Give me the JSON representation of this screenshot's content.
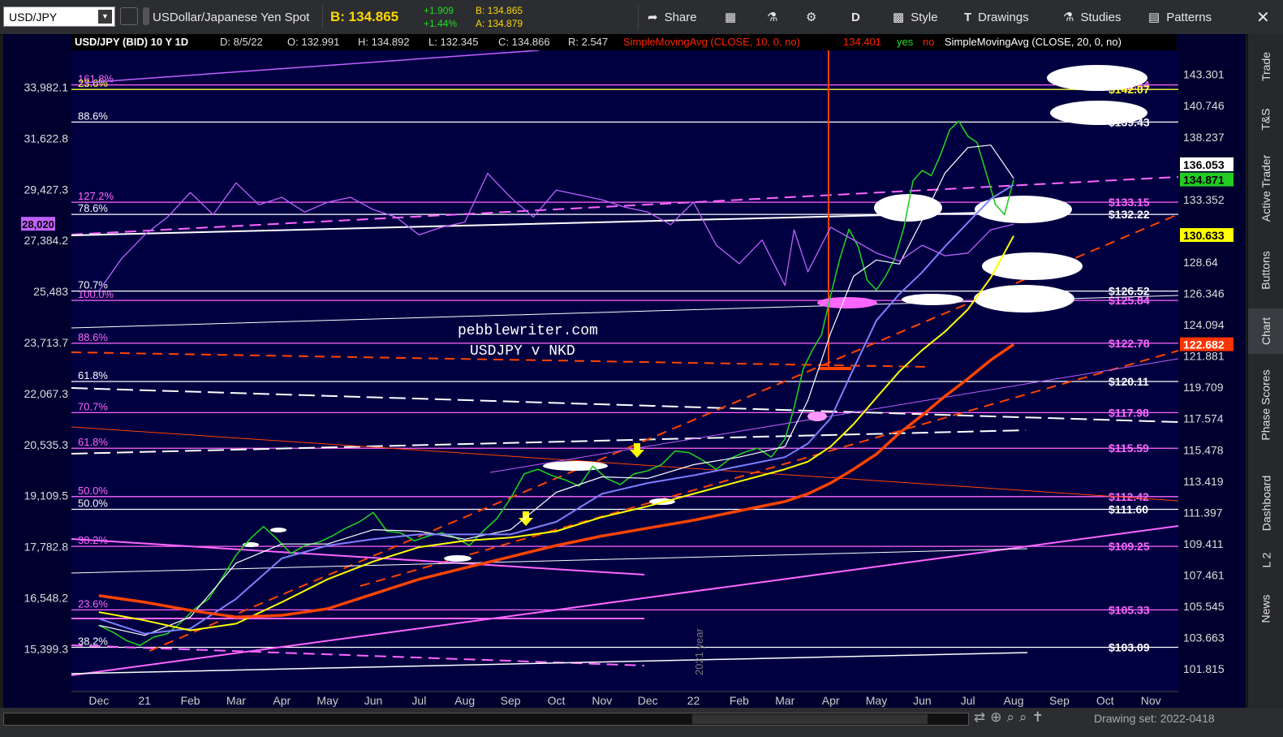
{
  "toolbar": {
    "symbol": "USD/JPY",
    "description": "USDollar/Japanese Yen Spot",
    "bid_label": "B: 134.865",
    "change_abs": "+1.909",
    "change_pct": "+1.44%",
    "bid_small": "B: 134.865",
    "ask_small": "A: 134.879",
    "share": "Share",
    "period": "D",
    "style": "Style",
    "drawings": "Drawings",
    "studies": "Studies",
    "patterns": "Patterns"
  },
  "sidebar": {
    "tabs": [
      "Trade",
      "T&S",
      "Active Trader",
      "Buttons",
      "Chart",
      "Phase Scores",
      "Dashboard",
      "L 2",
      "News"
    ]
  },
  "footer": {
    "drawing_set": "Drawing set: 2022-0418"
  },
  "colors": {
    "background": "#00002e",
    "price": "#22cc22",
    "sma10": "#ff2200",
    "sma20": "#ffffff",
    "sma50": "#7f7fff",
    "sma100": "#ffff00",
    "sma200": "#ff4400",
    "nikkei": "#c060ff",
    "fib": "#ff66ff"
  },
  "chart_data": {
    "type": "line",
    "header": {
      "title": "USD/JPY (BID) 10 Y 1D",
      "date": "D: 8/5/22",
      "open": "O: 132.991",
      "high": "H: 134.892",
      "low": "L: 132.345",
      "close": "C: 134.866",
      "range": "R: 2.547",
      "study1": "SimpleMovingAvg (CLOSE, 10, 0, no)",
      "study1_value": "134.401",
      "flag_yes": "yes",
      "flag_no": "no",
      "study2": "SimpleMovingAvg (CLOSE, 20, 0, no)"
    },
    "annotation_lines": [
      "pebblewriter.com",
      "USDJPY v NKD"
    ],
    "vertical_label": "2021 year",
    "x_ticks": [
      "Dec",
      "21",
      "Feb",
      "Mar",
      "Apr",
      "May",
      "Jun",
      "Jul",
      "Aug",
      "Sep",
      "Oct",
      "Nov",
      "Dec",
      "22",
      "Feb",
      "Mar",
      "Apr",
      "May",
      "Jun",
      "Jul",
      "Aug",
      "Sep",
      "Oct",
      "Nov"
    ],
    "x_tick_months": [
      0,
      1,
      2,
      3,
      4,
      5,
      6,
      7,
      8,
      9,
      10,
      11,
      12,
      13,
      14,
      15,
      16,
      17,
      18,
      19,
      20,
      21,
      22,
      23
    ],
    "xlim_months": [
      -0.6,
      23.6
    ],
    "right_axis": {
      "ylim": [
        100.5,
        145.3
      ],
      "ticks": [
        "143.301",
        "140.746",
        "138.237",
        "133.352",
        "128.64",
        "126.346",
        "124.094",
        "121.881",
        "119.709",
        "117.574",
        "115.478",
        "113.419",
        "111.397",
        "109.411",
        "107.461",
        "105.545",
        "103.663",
        "101.815"
      ],
      "tick_values": [
        143.301,
        140.746,
        138.237,
        133.352,
        128.64,
        126.346,
        124.094,
        121.881,
        119.709,
        117.574,
        115.478,
        113.419,
        111.397,
        109.411,
        107.461,
        105.545,
        103.663,
        101.815
      ]
    },
    "left_axis": {
      "ylim": [
        14500,
        35800
      ],
      "ticks": [
        "33,982.1",
        "31,622.8",
        "29,427.3",
        "27,384.2",
        "25,483",
        "23,713.7",
        "22,067.3",
        "20,535.3",
        "19,109.5",
        "17,782.8",
        "16,548.2",
        "15,399.3"
      ],
      "tick_values": [
        33982.1,
        31622.8,
        29427.3,
        27384.2,
        25483,
        23713.7,
        22067.3,
        20535.3,
        19109.5,
        17782.8,
        16548.2,
        15399.3
      ],
      "current_label": "28,020",
      "current_value": 28020
    },
    "price_badges": [
      {
        "label": "136.053",
        "value": 136.053,
        "color": "#ffffff",
        "text": "#000000"
      },
      {
        "label": "134.871",
        "value": 134.871,
        "color": "#22cc22",
        "text": "#000000"
      },
      {
        "label": "130.633",
        "value": 130.633,
        "color": "#ffff00",
        "text": "#000000"
      },
      {
        "label": "122.682",
        "value": 122.682,
        "color": "#ff3300",
        "text": "#ffffff"
      }
    ],
    "levels": [
      {
        "left": "161.8%",
        "right": "$142.44",
        "value": 142.44,
        "color": "#ff66ff"
      },
      {
        "left": "23.6%",
        "right": "$142.07",
        "value": 142.07,
        "color": "#ffff33"
      },
      {
        "left": "88.6%",
        "right": "$139.43",
        "value": 139.43,
        "color": "#ffffff"
      },
      {
        "left": "127.2%",
        "right": "$133.15",
        "value": 133.15,
        "color": "#ff66ff"
      },
      {
        "left": "78.6%",
        "right": "$132.22",
        "value": 132.22,
        "color": "#ffffff"
      },
      {
        "left": "70.7%",
        "right": "$126.52",
        "value": 126.52,
        "color": "#ffffff"
      },
      {
        "left": "100.0%",
        "right": "$125.84",
        "value": 125.84,
        "color": "#ff66ff"
      },
      {
        "left": "88.6%",
        "right": "$122.78",
        "value": 122.78,
        "color": "#ff66ff"
      },
      {
        "left": "61.8%",
        "right": "$120.11",
        "value": 120.11,
        "color": "#ffffff"
      },
      {
        "left": "70.7%",
        "right": "$117.98",
        "value": 117.98,
        "color": "#ff66ff"
      },
      {
        "left": "61.8%",
        "right": "$115.59",
        "value": 115.59,
        "color": "#ff66ff"
      },
      {
        "left": "50.0%",
        "right": "$112.42",
        "value": 112.42,
        "color": "#ff66ff"
      },
      {
        "left": "50.0%",
        "right": "$111.60",
        "value": 111.6,
        "color": "#ffffff"
      },
      {
        "left": "38.2%",
        "right": "$109.25",
        "value": 109.25,
        "color": "#ff66ff"
      },
      {
        "left": "23.6%",
        "right": "$105.33",
        "value": 105.33,
        "color": "#ff66ff"
      },
      {
        "left": "38.2%",
        "right": "$103.09",
        "value": 103.09,
        "color": "#ffffff"
      }
    ],
    "series": [
      {
        "key": "price",
        "x": [
          0,
          0.3,
          0.6,
          0.9,
          1.2,
          1.5,
          1.8,
          2.1,
          2.4,
          2.7,
          3.0,
          3.3,
          3.6,
          3.9,
          4.2,
          4.5,
          4.8,
          5.1,
          5.4,
          5.7,
          6.0,
          6.3,
          6.6,
          6.9,
          7.2,
          7.5,
          7.8,
          8.1,
          8.4,
          8.7,
          9.0,
          9.3,
          9.6,
          9.9,
          10.2,
          10.5,
          10.8,
          11.1,
          11.4,
          11.7,
          12.0,
          12.3,
          12.6,
          12.9,
          13.2,
          13.5,
          13.8,
          14.1,
          14.4,
          14.7,
          15.0,
          15.2,
          15.4,
          15.6,
          15.8,
          16.0,
          16.2,
          16.4,
          16.6,
          16.8,
          17.0,
          17.2,
          17.4,
          17.6,
          17.8,
          18.0,
          18.2,
          18.4,
          18.6,
          18.8,
          19.0,
          19.2,
          19.4,
          19.6,
          19.8,
          20.0
        ],
        "y": [
          104.4,
          104.0,
          103.5,
          103.2,
          103.7,
          103.9,
          104.6,
          105.4,
          106.0,
          107.3,
          108.7,
          109.7,
          110.5,
          109.7,
          108.8,
          109.3,
          109.5,
          109.9,
          110.4,
          110.8,
          111.4,
          110.2,
          110.1,
          109.6,
          109.9,
          110.1,
          109.8,
          109.3,
          110.2,
          111.0,
          112.3,
          113.9,
          114.2,
          113.8,
          113.5,
          113.1,
          114.4,
          113.6,
          113.2,
          113.9,
          114.1,
          114.5,
          115.4,
          115.3,
          114.8,
          114.2,
          114.9,
          115.3,
          115.6,
          115.0,
          116.2,
          118.3,
          121.0,
          122.3,
          123.4,
          126.2,
          128.9,
          131.1,
          129.8,
          127.3,
          126.6,
          127.6,
          128.9,
          131.2,
          134.8,
          135.6,
          135.2,
          136.8,
          138.8,
          139.5,
          138.3,
          137.8,
          135.4,
          133.0,
          132.2,
          134.9
        ]
      },
      {
        "key": "sma20",
        "x": [
          0,
          1,
          2,
          3,
          4,
          5,
          6,
          7,
          8,
          9,
          10,
          11,
          12,
          13,
          14,
          15,
          15.5,
          16,
          16.5,
          17,
          17.5,
          18,
          18.5,
          19,
          19.5,
          20
        ],
        "y": [
          104.4,
          103.8,
          104.9,
          108.2,
          109.4,
          109.4,
          110.3,
          110.2,
          109.7,
          110.3,
          112.7,
          113.7,
          113.6,
          114.5,
          115.0,
          115.7,
          118.8,
          123.5,
          127.6,
          128.8,
          128.5,
          131.8,
          135.4,
          137.4,
          137.6,
          135.0
        ]
      },
      {
        "key": "sma50",
        "x": [
          0,
          1,
          2,
          3,
          4,
          5,
          6,
          7,
          8,
          9,
          10,
          11,
          12,
          13,
          14,
          15,
          15.5,
          16,
          16.5,
          17,
          17.5,
          18,
          18.5,
          19,
          19.5,
          20
        ],
        "y": [
          104.8,
          103.9,
          104.2,
          106.0,
          108.5,
          109.3,
          109.7,
          110.0,
          110.0,
          110.0,
          110.8,
          112.6,
          113.3,
          113.8,
          114.4,
          115.0,
          115.9,
          117.6,
          121.0,
          124.4,
          126.3,
          127.9,
          129.8,
          131.6,
          133.4,
          134.5
        ]
      },
      {
        "key": "sma100",
        "x": [
          0,
          1,
          2,
          3,
          4,
          5,
          6,
          7,
          8,
          9,
          10,
          11,
          12,
          13,
          14,
          15,
          15.5,
          16,
          16.5,
          17,
          17.5,
          18,
          18.5,
          19,
          19.5,
          20
        ],
        "y": [
          105.2,
          104.7,
          104.1,
          104.5,
          105.8,
          107.2,
          108.3,
          109.2,
          109.6,
          109.8,
          110.2,
          111.1,
          111.8,
          112.6,
          113.4,
          114.2,
          114.7,
          115.7,
          117.2,
          119.0,
          120.8,
          122.3,
          123.6,
          125.2,
          127.5,
          130.6
        ]
      },
      {
        "key": "sma200",
        "x": [
          0,
          1,
          2,
          3,
          4,
          5,
          6,
          7,
          8,
          9,
          10,
          11,
          12,
          13,
          14,
          15,
          15.5,
          16,
          16.5,
          17,
          17.5,
          18,
          18.5,
          19,
          19.5,
          20
        ],
        "y": [
          106.2,
          105.8,
          105.3,
          104.9,
          105.0,
          105.4,
          106.3,
          107.2,
          107.9,
          108.6,
          109.3,
          109.9,
          110.4,
          110.9,
          111.5,
          112.1,
          112.6,
          113.3,
          114.2,
          115.2,
          116.6,
          117.8,
          119.1,
          120.3,
          121.6,
          122.7
        ]
      },
      {
        "key": "nikkei",
        "x": [
          0,
          0.5,
          1,
          1.5,
          2,
          2.5,
          3,
          3.5,
          4,
          4.5,
          5,
          5.5,
          6,
          6.5,
          7,
          7.5,
          8,
          8.5,
          9,
          9.5,
          10,
          10.5,
          11,
          11.5,
          12,
          12.5,
          13,
          13.5,
          14,
          14.5,
          15,
          15.2,
          15.5,
          16,
          16.5,
          17,
          17.5,
          18,
          18.5,
          19,
          19.5,
          20
        ],
        "y": [
          25500,
          26700,
          27600,
          28300,
          29300,
          28400,
          29700,
          28800,
          29100,
          28500,
          28900,
          29100,
          28600,
          28300,
          27600,
          27900,
          28100,
          30100,
          29100,
          28300,
          29400,
          29200,
          29000,
          28700,
          28500,
          28000,
          28900,
          27200,
          26500,
          27400,
          25700,
          27800,
          26200,
          27900,
          27400,
          26900,
          26600,
          27200,
          26800,
          26900,
          27800,
          28020
        ]
      }
    ]
  }
}
